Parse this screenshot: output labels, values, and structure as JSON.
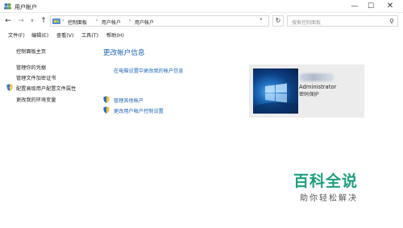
{
  "window": {
    "title": "用户帐户",
    "minimize_glyph": "—",
    "maximize_glyph": "☐",
    "close_glyph": "✕"
  },
  "nav": {
    "back_glyph": "←",
    "forward_glyph": "→",
    "recent_glyph": "∨",
    "up_glyph": "↑"
  },
  "address": {
    "crumbs": [
      "控制面板",
      "用户帐户",
      "用户帐户"
    ],
    "separator": "›",
    "dropdown_glyph": "∨",
    "refresh_glyph": "↻"
  },
  "search": {
    "placeholder": "搜索控制面板",
    "icon_glyph": "⚲"
  },
  "menu": [
    {
      "label": "文件(F)"
    },
    {
      "label": "编辑(E)"
    },
    {
      "label": "查看(V)"
    },
    {
      "label": "工具(T)"
    },
    {
      "label": "帮助(H)"
    }
  ],
  "sidebar": {
    "items": [
      {
        "label": "控制面板主页"
      },
      {
        "label": "管理你的凭据"
      },
      {
        "label": "管理文件加密证书"
      },
      {
        "label": "配置高级用户配置文件属性"
      },
      {
        "label": "更改我的环境变量"
      }
    ]
  },
  "main": {
    "title": "更改帐户信息",
    "change_in_settings": "在电脑设置中更改我的帐户信息",
    "manage_other": "管理其他帐户",
    "uac_settings": "更改用户帐户控制设置"
  },
  "account": {
    "name": "Administrator",
    "status": "密码保护"
  },
  "watermark": {
    "title": "百科全说",
    "subtitle": "助你轻松解决"
  },
  "colors": {
    "link": "#2166b7",
    "title_blue": "#1a62b3",
    "watermark_green": "#1e9e7f"
  }
}
